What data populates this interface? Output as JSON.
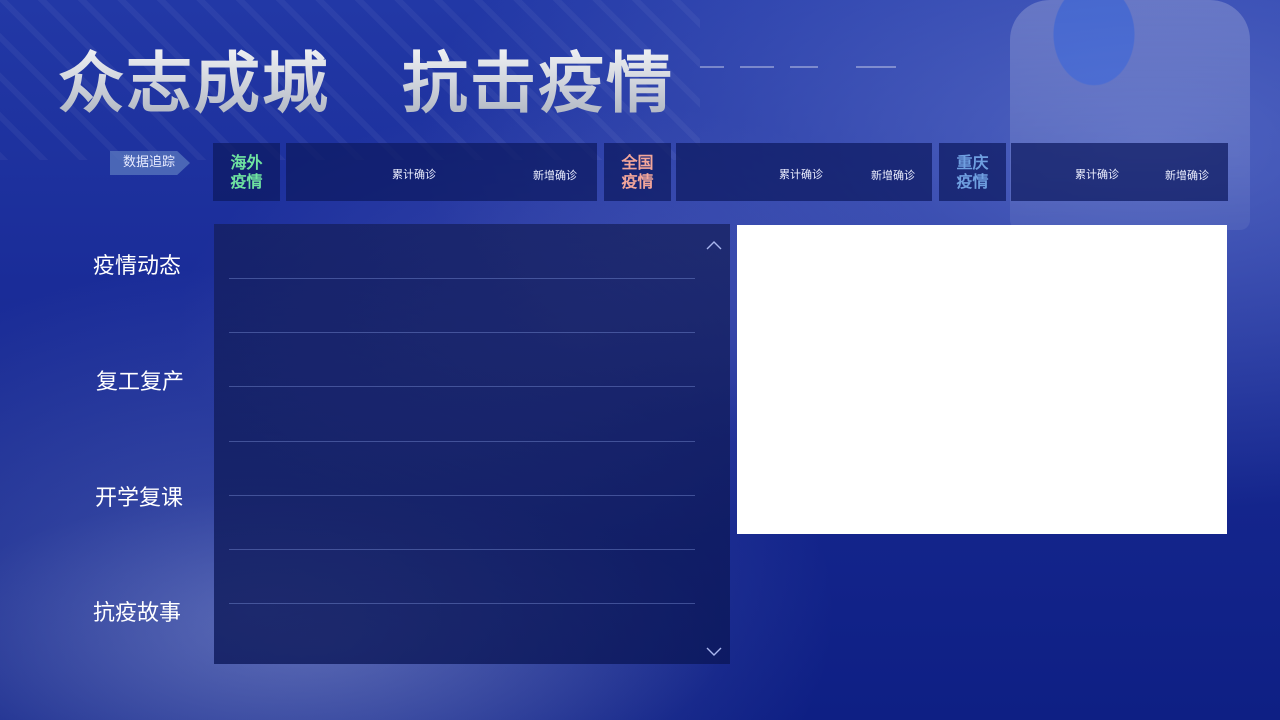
{
  "header": {
    "title_part1": "众志成城",
    "title_part2": "抗击疫情"
  },
  "tracker": {
    "tag": "数据追踪",
    "groups": [
      {
        "badge_line1": "海外",
        "badge_line2": "疫情",
        "badge_color": "#6fe3a0",
        "cumulative_label": "累计确诊",
        "new_label": "新增确诊"
      },
      {
        "badge_line1": "全国",
        "badge_line2": "疫情",
        "badge_color": "#f3a69a",
        "cumulative_label": "累计确诊",
        "new_label": "新增确诊"
      },
      {
        "badge_line1": "重庆",
        "badge_line2": "疫情",
        "badge_color": "#6f9fe0",
        "cumulative_label": "累计确诊",
        "new_label": "新增确诊"
      }
    ]
  },
  "nav": {
    "items": [
      "疫情动态",
      "复工复产",
      "开学复课",
      "抗疫故事"
    ]
  },
  "icons": {
    "scroll_up": "chevron-up-icon",
    "scroll_down": "chevron-down-icon"
  }
}
